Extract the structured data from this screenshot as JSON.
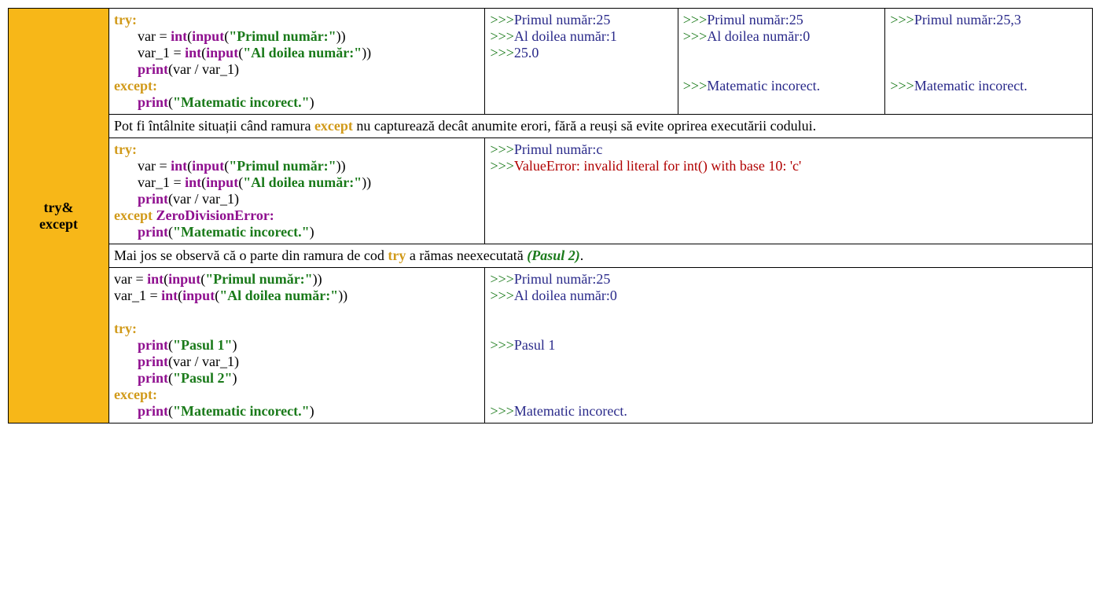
{
  "side_label_1": "try&",
  "side_label_2": "except",
  "code1": {
    "l1_kw": "try:",
    "l2_pre": "var = ",
    "l2_int": "int",
    "l2_par1": "(",
    "l2_input": "input",
    "l2_par2": "(",
    "l2_str": "\"Primul număr:\"",
    "l2_close": "))",
    "l3_pre": "var_1 = ",
    "l3_int": "int",
    "l3_par1": "(",
    "l3_input": "input",
    "l3_par2": "(",
    "l3_str": "\"Al doilea număr:\"",
    "l3_close": "))",
    "l4_fn": "print",
    "l4_args": "(var / var_1)",
    "l5_kw": "except:",
    "l6_fn": "print",
    "l6_par": "(",
    "l6_str": "\"Matematic incorect.\"",
    "l6_close": ")"
  },
  "out1a": {
    "l1_p": ">>>",
    "l1_t": "Primul număr:25",
    "l2_p": ">>>",
    "l2_t": "Al doilea număr:1",
    "l3_p": ">>>",
    "l3_t": "25.0"
  },
  "out1b": {
    "l1_p": ">>>",
    "l1_t": "Primul număr:25",
    "l2_p": ">>>",
    "l2_t": "Al doilea număr:0",
    "l3_p": ">>>",
    "l3_t": "Matematic incorect."
  },
  "out1c": {
    "l1_p": ">>>",
    "l1_t": "Primul număr:25,3",
    "l2_p": ">>>",
    "l2_t": "Matematic incorect."
  },
  "note1_a": "Pot fi întâlnite situații când ramura ",
  "note1_b": "except",
  "note1_c": " nu capturează decât anumite erori, fără a reuși să evite oprirea executării codului.",
  "code2": {
    "l1_kw": "try:",
    "l2_pre": "var = ",
    "l2_int": "int",
    "l2_par1": "(",
    "l2_input": "input",
    "l2_par2": "(",
    "l2_str": "\"Primul număr:\"",
    "l2_close": "))",
    "l3_pre": "var_1 = ",
    "l3_int": "int",
    "l3_par1": "(",
    "l3_input": "input",
    "l3_par2": "(",
    "l3_str": "\"Al doilea număr:\"",
    "l3_close": "))",
    "l4_fn": "print",
    "l4_args": "(var / var_1)",
    "l5_kw": "except ",
    "l5_ex": "ZeroDivisionError:",
    "l6_fn": "print",
    "l6_par": "(",
    "l6_str": "\"Matematic incorect.\"",
    "l6_close": ")"
  },
  "out2": {
    "l1_p": ">>>",
    "l1_t": "Primul număr:c",
    "l2_p": ">>>",
    "l2_t": "ValueError: invalid literal for int() with base 10: 'c'"
  },
  "note2_a": "Mai jos se observă că o parte din ramura de cod ",
  "note2_b": "try",
  "note2_c": " a rămas neexecutată ",
  "note2_d": "(Pasul 2)",
  "note2_e": ".",
  "code3": {
    "l1_pre": "var = ",
    "l1_int": "int",
    "l1_par1": "(",
    "l1_input": "input",
    "l1_par2": "(",
    "l1_str": "\"Primul număr:\"",
    "l1_close": "))",
    "l2_pre": "var_1 = ",
    "l2_int": "int",
    "l2_par1": "(",
    "l2_input": "input",
    "l2_par2": "(",
    "l2_str": "\"Al doilea număr:\"",
    "l2_close": "))",
    "l3_kw": "try:",
    "l4_fn": "print",
    "l4_par": "(",
    "l4_str": "\"Pasul 1\"",
    "l4_close": ")",
    "l5_fn": "print",
    "l5_args": "(var / var_1)",
    "l6_fn": "print",
    "l6_par": "(",
    "l6_str": "\"Pasul 2\"",
    "l6_close": ")",
    "l7_kw": "except:",
    "l8_fn": "print",
    "l8_par": "(",
    "l8_str": "\"Matematic incorect.\"",
    "l8_close": ")"
  },
  "out3": {
    "l1_p": ">>>",
    "l1_t": "Primul număr:25",
    "l2_p": ">>>",
    "l2_t": "Al doilea număr:0",
    "l3_p": ">>>",
    "l3_t": "Pasul 1",
    "l4_p": ">>>",
    "l4_t": "Matematic incorect."
  }
}
